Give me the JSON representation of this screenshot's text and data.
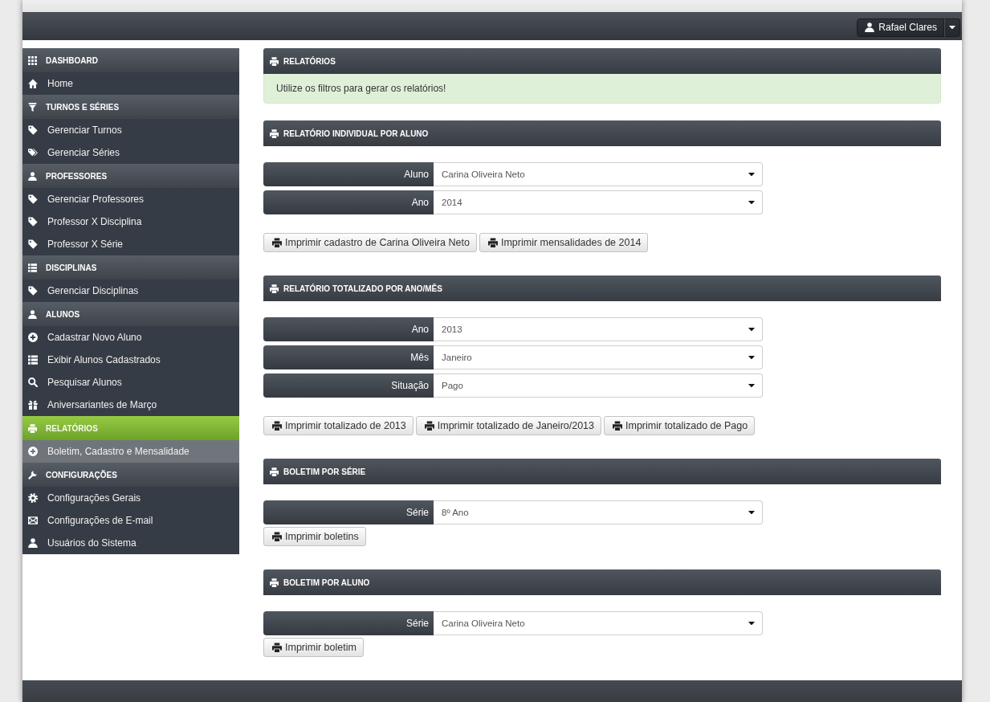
{
  "topbar": {
    "user_menu": {
      "name": "Rafael Clares"
    }
  },
  "sidebar": {
    "sections": [
      {
        "title": "DASHBOARD",
        "active": false,
        "items": [
          {
            "label": "Home",
            "selected": false
          }
        ]
      },
      {
        "title": "TURNOS E SÉRIES",
        "active": false,
        "items": [
          {
            "label": "Gerenciar Turnos",
            "selected": false
          },
          {
            "label": "Gerenciar Séries",
            "selected": false
          }
        ]
      },
      {
        "title": "PROFESSORES",
        "active": false,
        "items": [
          {
            "label": "Gerenciar Professores",
            "selected": false
          },
          {
            "label": "Professor X Disciplina",
            "selected": false
          },
          {
            "label": "Professor X Série",
            "selected": false
          }
        ]
      },
      {
        "title": "DISCIPLINAS",
        "active": false,
        "items": [
          {
            "label": "Gerenciar Disciplinas",
            "selected": false
          }
        ]
      },
      {
        "title": "ALUNOS",
        "active": false,
        "items": [
          {
            "label": "Cadastrar Novo Aluno",
            "selected": false
          },
          {
            "label": "Exibir Alunos Cadastrados",
            "selected": false
          },
          {
            "label": "Pesquisar Alunos",
            "selected": false
          },
          {
            "label": "Aniversariantes de Março",
            "selected": false
          }
        ]
      },
      {
        "title": "RELATÓRIOS",
        "active": true,
        "items": [
          {
            "label": "Boletim, Cadastro e Mensalidade",
            "selected": true
          }
        ]
      },
      {
        "title": "CONFIGURAÇÕES",
        "active": false,
        "items": [
          {
            "label": "Configurações Gerais",
            "selected": false
          },
          {
            "label": "Configurações de E-mail",
            "selected": false
          },
          {
            "label": "Usuários do Sistema",
            "selected": false
          }
        ]
      }
    ]
  },
  "panels": [
    {
      "kind": "alert",
      "title": "RELATÓRIOS",
      "alert": "Utilize os filtros para gerar os relatórios!"
    },
    {
      "kind": "report",
      "title": "RELATÓRIO INDIVIDUAL POR ALUNO",
      "fields": [
        {
          "label": "Aluno",
          "value": "Carina Oliveira Neto"
        },
        {
          "label": "Ano",
          "value": "2014"
        }
      ],
      "buttons": [
        "Imprimir cadastro de Carina Oliveira Neto",
        "Imprimir mensalidades de 2014"
      ]
    },
    {
      "kind": "report",
      "title": "RELATÓRIO TOTALIZADO POR ANO/MÊS",
      "fields": [
        {
          "label": "Ano",
          "value": "2013"
        },
        {
          "label": "Mês",
          "value": "Janeiro"
        },
        {
          "label": "Situação",
          "value": "Pago"
        }
      ],
      "buttons": [
        "Imprimir totalizado de 2013",
        "Imprimir totalizado de Janeiro/2013",
        "Imprimir totalizado de Pago"
      ]
    },
    {
      "kind": "bulletin",
      "title": "BOLETIM POR SÉRIE",
      "fields": [
        {
          "label": "Série",
          "value": "8º Ano"
        }
      ],
      "buttons": [
        "Imprimir boletins"
      ]
    },
    {
      "kind": "bulletin",
      "title": "BOLETIM POR ALUNO",
      "fields": [
        {
          "label": "Série",
          "value": "Carina Oliveira Neto"
        }
      ],
      "buttons": [
        "Imprimir boletim"
      ]
    }
  ]
}
